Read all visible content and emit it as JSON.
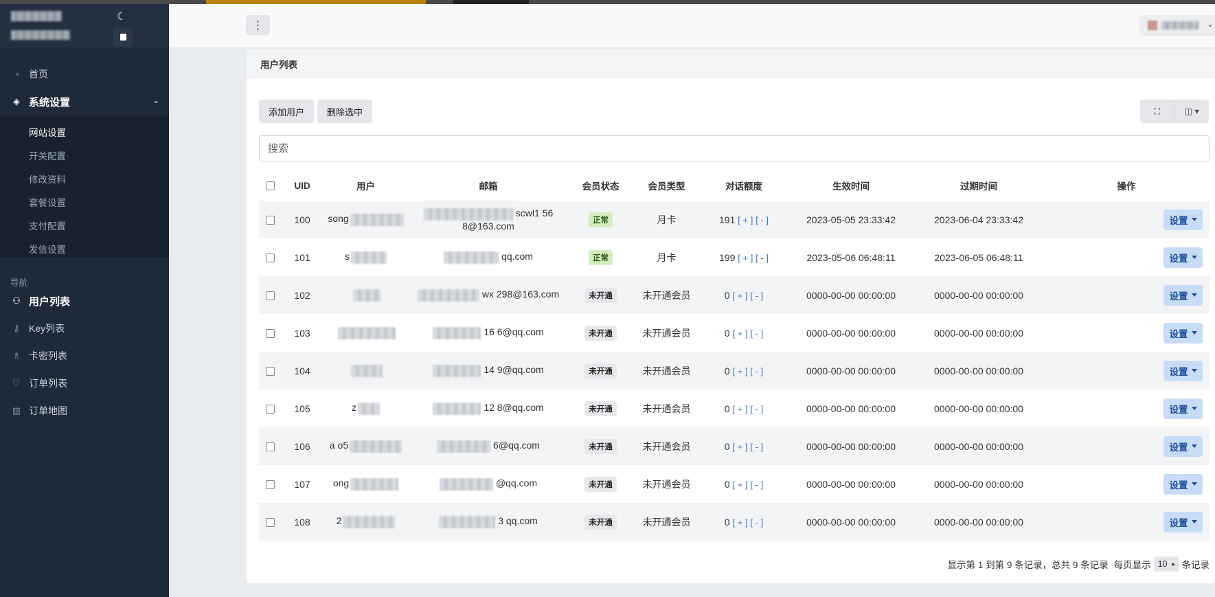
{
  "sidebar": {
    "menu": [
      {
        "label": "首页",
        "icon": "dashboard-icon"
      },
      {
        "label": "系统设置",
        "icon": "layers-icon"
      }
    ],
    "submenu": [
      "网站设置",
      "开关配置",
      "修改资料",
      "套餐设置",
      "支付配置",
      "发信设置"
    ],
    "section": "导航",
    "nav": [
      {
        "label": "用户列表",
        "icon": "users-icon"
      },
      {
        "label": "Key列表",
        "icon": "key-icon"
      },
      {
        "label": "卡密列表",
        "icon": "chess-icon"
      },
      {
        "label": "订单列表",
        "icon": "heart-icon"
      },
      {
        "label": "订单地图",
        "icon": "map-icon"
      }
    ]
  },
  "card": {
    "title": "用户列表",
    "add_button": "添加用户",
    "delete_button": "删除选中",
    "search_placeholder": "搜索"
  },
  "table": {
    "headers": [
      "UID",
      "用户",
      "邮箱",
      "会员状态",
      "会员类型",
      "对话额度",
      "生效时间",
      "过期时间",
      "操作"
    ],
    "plus_label": "[ + ]",
    "minus_label": "[ - ]",
    "action_label": "设置",
    "rows": [
      {
        "uid": "100",
        "username": "song",
        "email": "scwl1 56 8@163.com",
        "status": "正常",
        "type": "月卡",
        "quota": "191",
        "start": "2023-05-05 23:33:42",
        "end": "2023-06-04 23:33:42"
      },
      {
        "uid": "101",
        "username": "s",
        "email": "qq.com",
        "status": "正常",
        "type": "月卡",
        "quota": "199",
        "start": "2023-05-06 06:48:11",
        "end": "2023-06-05 06:48:11"
      },
      {
        "uid": "102",
        "username": "",
        "email": "wx 298@163.com",
        "status": "未开通",
        "type": "未开通会员",
        "quota": "0",
        "start": "0000-00-00 00:00:00",
        "end": "0000-00-00 00:00:00"
      },
      {
        "uid": "103",
        "username": "",
        "email": "16 6@qq.com",
        "status": "未开通",
        "type": "未开通会员",
        "quota": "0",
        "start": "0000-00-00 00:00:00",
        "end": "0000-00-00 00:00:00"
      },
      {
        "uid": "104",
        "username": "",
        "email": "14 9@qq.com",
        "status": "未开通",
        "type": "未开通会员",
        "quota": "0",
        "start": "0000-00-00 00:00:00",
        "end": "0000-00-00 00:00:00"
      },
      {
        "uid": "105",
        "username": "z",
        "email": "12 8@qq.com",
        "status": "未开通",
        "type": "未开通会员",
        "quota": "0",
        "start": "0000-00-00 00:00:00",
        "end": "0000-00-00 00:00:00"
      },
      {
        "uid": "106",
        "username": "a o5",
        "email": "6@qq.com",
        "status": "未开通",
        "type": "未开通会员",
        "quota": "0",
        "start": "0000-00-00 00:00:00",
        "end": "0000-00-00 00:00:00"
      },
      {
        "uid": "107",
        "username": "ong",
        "email": "@qq.com",
        "status": "未开通",
        "type": "未开通会员",
        "quota": "0",
        "start": "0000-00-00 00:00:00",
        "end": "0000-00-00 00:00:00"
      },
      {
        "uid": "108",
        "username": "2",
        "email": "3 qq.com",
        "status": "未开通",
        "type": "未开通会员",
        "quota": "0",
        "start": "0000-00-00 00:00:00",
        "end": "0000-00-00 00:00:00"
      }
    ]
  },
  "pagination": {
    "summary": "显示第 1 到第 9 条记录，总共 9 条记录",
    "per_page_prefix": "每页显示",
    "per_page_value": "10",
    "per_page_suffix": "条记录"
  }
}
